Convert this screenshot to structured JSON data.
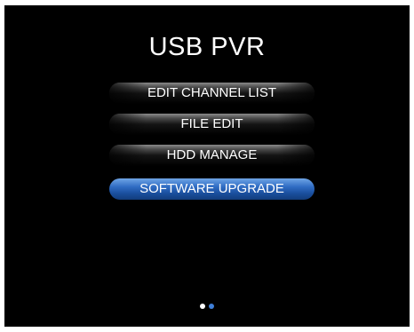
{
  "screen": {
    "title": "USB PVR"
  },
  "menu": {
    "items": [
      {
        "label": "EDIT CHANNEL LIST",
        "selected": false
      },
      {
        "label": "FILE EDIT",
        "selected": false
      },
      {
        "label": "HDD MANAGE",
        "selected": false
      },
      {
        "label": "SOFTWARE UPGRADE",
        "selected": true
      }
    ]
  },
  "pager": {
    "pages": 2,
    "current_page": 2,
    "inactive_color": "#ffffff",
    "active_color": "#3f7fd8"
  },
  "colors": {
    "background": "#000000",
    "text": "#ffffff",
    "selection": "#2f6cc3"
  }
}
